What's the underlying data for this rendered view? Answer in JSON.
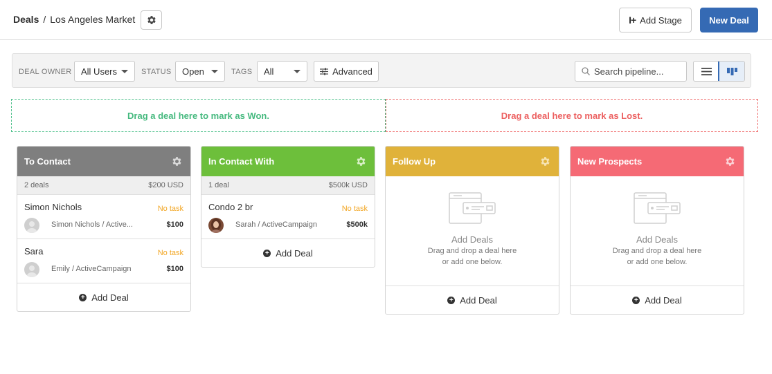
{
  "header": {
    "breadcrumb_root": "Deals",
    "breadcrumb_sep": "/",
    "breadcrumb_current": "Los Angeles Market",
    "add_stage_label": "Add Stage",
    "new_deal_label": "New Deal"
  },
  "filters": {
    "deal_owner_label": "DEAL OWNER",
    "deal_owner_value": "All Users",
    "status_label": "STATUS",
    "status_value": "Open",
    "tags_label": "TAGS",
    "tags_value": "All",
    "advanced_label": "Advanced",
    "search_placeholder": "Search pipeline..."
  },
  "dropzones": {
    "won_text": "Drag a deal here to mark as Won.",
    "lost_text": "Drag a deal here to mark as Lost."
  },
  "colors": {
    "primary": "#356ab4",
    "won": "#45b97e",
    "lost": "#ec5f5f",
    "task": "#f2a623",
    "stage_to_contact": "#7f7f7f",
    "stage_in_contact": "#6dbf3b",
    "stage_follow_up": "#e0b23a",
    "stage_new_prospects": "#f56a75"
  },
  "stages": [
    {
      "title": "To Contact",
      "summary_count": "2 deals",
      "summary_value": "$200 USD",
      "deals": [
        {
          "title": "Simon Nichols",
          "task": "No task",
          "contact": "Simon Nichols / Active...",
          "value": "$100"
        },
        {
          "title": "Sara",
          "task": "No task",
          "contact": "Emily / ActiveCampaign",
          "value": "$100"
        }
      ],
      "add_label": "Add Deal"
    },
    {
      "title": "In Contact With",
      "summary_count": "1 deal",
      "summary_value": "$500k USD",
      "deals": [
        {
          "title": "Condo 2 br",
          "task": "No task",
          "contact": "Sarah / ActiveCampaign",
          "value": "$500k"
        }
      ],
      "add_label": "Add Deal"
    },
    {
      "title": "Follow Up",
      "empty_title": "Add Deals",
      "empty_line1": "Drag and drop a deal here",
      "empty_line2": "or add one below.",
      "add_label": "Add Deal"
    },
    {
      "title": "New Prospects",
      "empty_title": "Add Deals",
      "empty_line1": "Drag and drop a deal here",
      "empty_line2": "or add one below.",
      "add_label": "Add Deal"
    }
  ]
}
